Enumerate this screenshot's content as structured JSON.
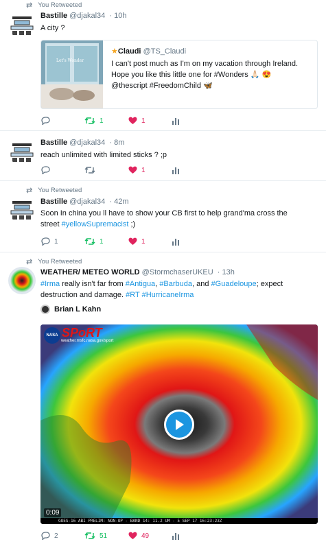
{
  "tweets": [
    {
      "retweet_label": "You Retweeted",
      "name": "Bastille",
      "handle": "@djakal34",
      "time": "10h",
      "text": "A city ?",
      "quote": {
        "name": "Claudi",
        "handle": "@TS_Claudi",
        "text_line1": "I can't post much as I'm on my vacation through Ireland.",
        "text_line2": "Hope you like this little one for #Wonders 🙏🏻 😍",
        "text_line3": "@thescript #FreedomChild 🦋",
        "image_text": "Let's Wonder"
      },
      "replies": "",
      "retweets": "1",
      "likes": "1"
    },
    {
      "name": "Bastille",
      "handle": "@djakal34",
      "time": "8m",
      "text": "reach unlimited with limited sticks ? ;p",
      "replies": "",
      "retweets": "",
      "likes": "1"
    },
    {
      "retweet_label": "You Retweeted",
      "name": "Bastille",
      "handle": "@djakal34",
      "time": "42m",
      "text_line1": "Soon In china you ll have to show your CB first to help grand'ma cross the",
      "text_line2_plain": "street ",
      "text_line2_link": "#yellowSupremacist",
      "text_line2_tail": " ;)",
      "replies": "1",
      "retweets": "1",
      "likes": "1"
    },
    {
      "retweet_label": "You Retweeted",
      "name": "WEATHER/ METEO WORLD",
      "handle": "@StormchaserUKEU",
      "time": "13h",
      "line1": [
        {
          "t": "#Irma",
          "link": true
        },
        {
          "t": " really isn't far from ",
          "link": false
        },
        {
          "t": "#Antigua",
          "link": true
        },
        {
          "t": ", ",
          "link": false
        },
        {
          "t": "#Barbuda",
          "link": true
        },
        {
          "t": ", and ",
          "link": false
        },
        {
          "t": "#Guadeloupe",
          "link": true
        },
        {
          "t": "; expect",
          "link": false
        }
      ],
      "line2": [
        {
          "t": "destruction and damage. ",
          "link": false
        },
        {
          "t": "#RT",
          "link": true
        },
        {
          "t": " ",
          "link": false
        },
        {
          "t": "#HurricaneIrma",
          "link": true
        }
      ],
      "attribution": "Brian L Kahn",
      "video": {
        "logo_nasa": "NASA",
        "logo_sport": "SPoRT",
        "url_text": "weather.msfc.nasa.gov/sport",
        "duration": "0:09",
        "caption": "GOES-16 ABI PRELIM: NON-OP - BAND 14: 11.2 UM - 5 SEP 17 16:23:23Z"
      },
      "replies": "2",
      "retweets": "51",
      "likes": "49"
    }
  ],
  "colors": {
    "link": "#1b95e0",
    "retweet_green": "#17bf63",
    "like_red": "#e0245e",
    "muted": "#657786"
  }
}
